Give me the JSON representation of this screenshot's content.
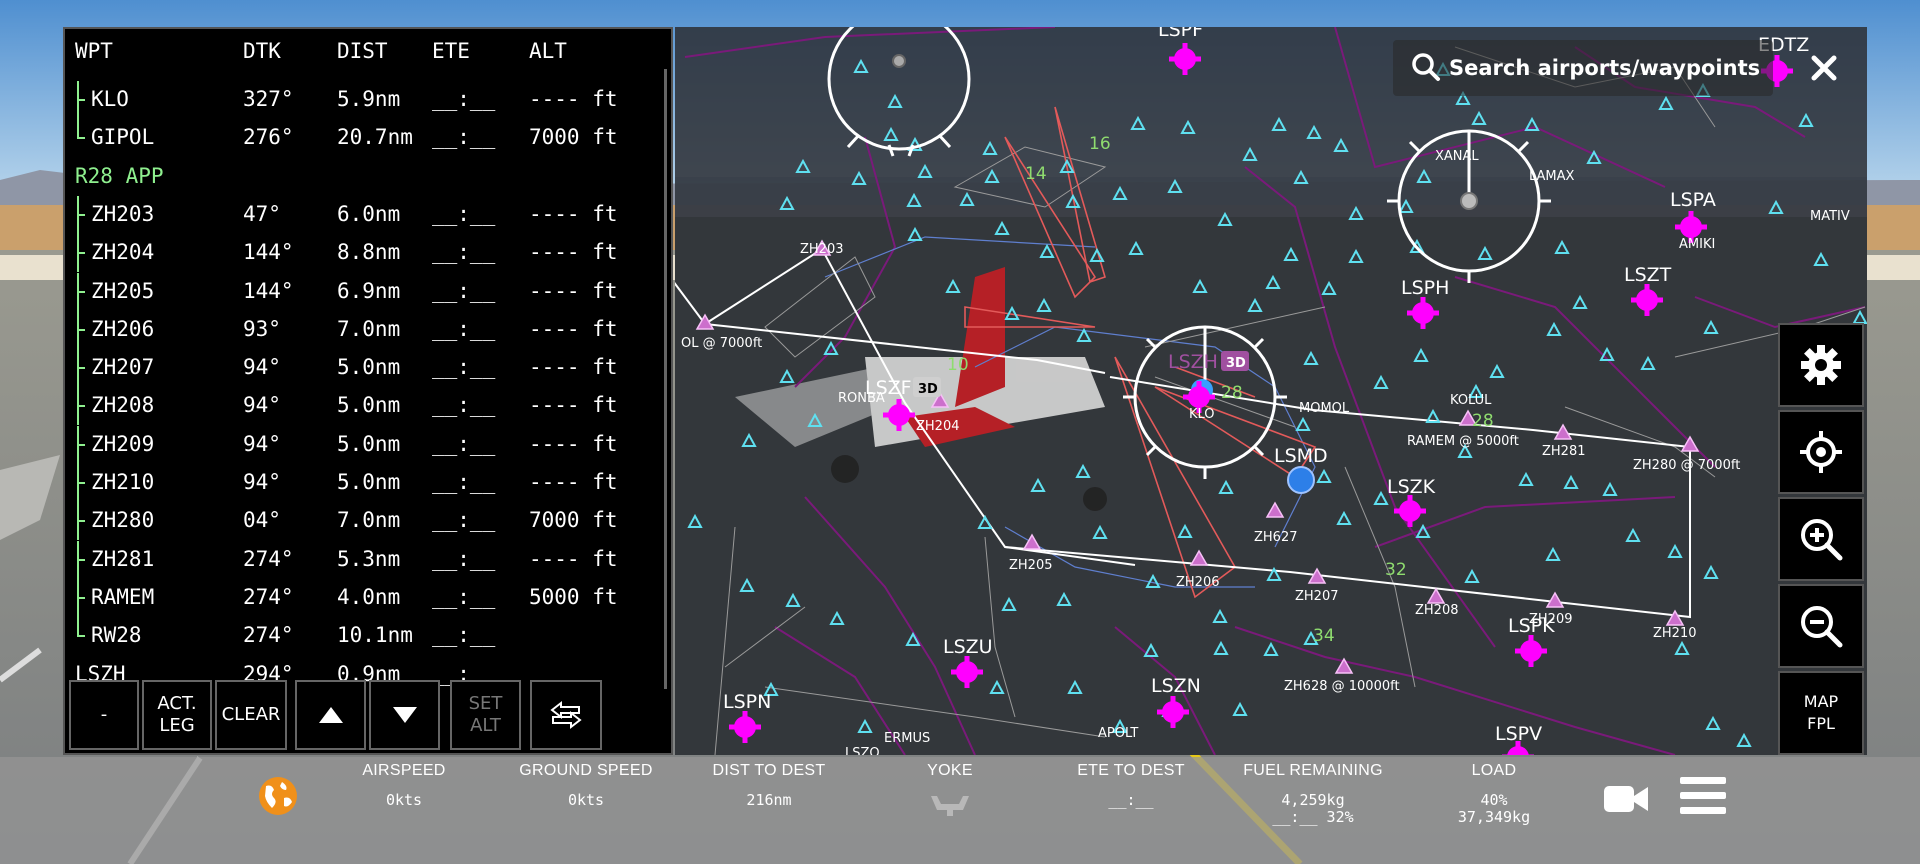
{
  "flight_plan": {
    "headers": {
      "wpt": "WPT",
      "dtk": "DTK",
      "dist": "DIST",
      "ete": "ETE",
      "alt": "ALT"
    },
    "rows": [
      {
        "wpt": "KLO",
        "dtk": "327°",
        "dist": "5.9nm",
        "ete": "__:__",
        "alt": "---- ft",
        "kind": "leg"
      },
      {
        "wpt": "GIPOL",
        "dtk": "276°",
        "dist": "20.7nm",
        "ete": "__:__",
        "alt": "7000 ft",
        "kind": "leg-end"
      },
      {
        "wpt": "R28 APP",
        "dtk": "",
        "dist": "",
        "ete": "",
        "alt": "",
        "kind": "section"
      },
      {
        "wpt": "ZH203",
        "dtk": "47°",
        "dist": "6.0nm",
        "ete": "__:__",
        "alt": "---- ft",
        "kind": "leg"
      },
      {
        "wpt": "ZH204",
        "dtk": "144°",
        "dist": "8.8nm",
        "ete": "__:__",
        "alt": "---- ft",
        "kind": "leg"
      },
      {
        "wpt": "ZH205",
        "dtk": "144°",
        "dist": "6.9nm",
        "ete": "__:__",
        "alt": "---- ft",
        "kind": "leg"
      },
      {
        "wpt": "ZH206",
        "dtk": "93°",
        "dist": "7.0nm",
        "ete": "__:__",
        "alt": "---- ft",
        "kind": "leg"
      },
      {
        "wpt": "ZH207",
        "dtk": "94°",
        "dist": "5.0nm",
        "ete": "__:__",
        "alt": "---- ft",
        "kind": "leg"
      },
      {
        "wpt": "ZH208",
        "dtk": "94°",
        "dist": "5.0nm",
        "ete": "__:__",
        "alt": "---- ft",
        "kind": "leg"
      },
      {
        "wpt": "ZH209",
        "dtk": "94°",
        "dist": "5.0nm",
        "ete": "__:__",
        "alt": "---- ft",
        "kind": "leg"
      },
      {
        "wpt": "ZH210",
        "dtk": "94°",
        "dist": "5.0nm",
        "ete": "__:__",
        "alt": "---- ft",
        "kind": "leg"
      },
      {
        "wpt": "ZH280",
        "dtk": "04°",
        "dist": "7.0nm",
        "ete": "__:__",
        "alt": "7000 ft",
        "kind": "leg"
      },
      {
        "wpt": "ZH281",
        "dtk": "274°",
        "dist": "5.3nm",
        "ete": "__:__",
        "alt": "---- ft",
        "kind": "leg"
      },
      {
        "wpt": "RAMEM",
        "dtk": "274°",
        "dist": "4.0nm",
        "ete": "__:__",
        "alt": "5000 ft",
        "kind": "leg"
      },
      {
        "wpt": "RW28",
        "dtk": "274°",
        "dist": "10.1nm",
        "ete": "__:__",
        "alt": "",
        "kind": "leg-end"
      },
      {
        "wpt": "LSZH",
        "dtk": "294°",
        "dist": "0.9nm",
        "ete": "__:__",
        "alt": "",
        "kind": "top"
      }
    ],
    "buttons": {
      "minus": "-",
      "act_leg": "ACT.\nLEG",
      "clear": "CLEAR",
      "set_alt": "SET\nALT"
    }
  },
  "map": {
    "search_placeholder": "Search airports/waypoints",
    "map_fpl_label": "MAP\nFPL",
    "airports": [
      "LSPF",
      "EDTZ",
      "LSPA",
      "LSZT",
      "LSPH",
      "LSZH",
      "LSZF",
      "LSMD",
      "LSZK",
      "LSZU",
      "LSZN",
      "LSPN",
      "LSPK",
      "LSPV"
    ],
    "labels": {
      "lspf": "LSPF",
      "edtz": "EDTZ",
      "lspa": "LSPA",
      "lszt": "LSZT",
      "lsph": "LSPH",
      "lszh": "LSZH",
      "lszf": "LSZF",
      "lsmd": "LSMD",
      "lszk": "LSZK",
      "lszu": "LSZU",
      "lszn": "LSZN",
      "lspn": "LSPN",
      "lspk": "LSPK",
      "lspv": "LSPV",
      "lszo": "LSZO",
      "xanal": "XANAL",
      "lamax": "LAMAX",
      "amiki": "AMIKI",
      "mativ": "MATIV",
      "zh203": "ZH203",
      "ronba": "RONBA",
      "zh204": "ZH204",
      "zh205": "ZH205",
      "zh206": "ZH206",
      "zh207": "ZH207",
      "zh208": "ZH208",
      "zh209": "ZH209",
      "zh210": "ZH210",
      "zh280": "ZH280 @ 7000ft",
      "zh281": "ZH281",
      "ramem": "RAMEM @ 5000ft",
      "kolul": "KOLUL",
      "gipol": "OL @ 7000ft",
      "zh627": "ZH627",
      "zh628": "ZH628 @ 10000ft",
      "ermus": "ERMUS",
      "apolt": "APOLT",
      "klo": "KLO",
      "momol": "MOMOL",
      "badge3d": "3D",
      "rw14": "14",
      "rw16": "16",
      "rw10": "10",
      "rw28": "28",
      "rw32": "32",
      "rw34": "34",
      "rw28b": "28"
    }
  },
  "status_bar": {
    "airspeed": {
      "label": "AIRSPEED",
      "value": "0kts"
    },
    "ground_speed": {
      "label": "GROUND SPEED",
      "value": "0kts"
    },
    "dist_to_dest": {
      "label": "DIST TO DEST",
      "value": "216nm"
    },
    "yoke": {
      "label": "YOKE"
    },
    "ete_to_dest": {
      "label": "ETE TO DEST",
      "value": "__:__"
    },
    "fuel_remaining": {
      "label": "FUEL REMAINING",
      "value1": "4,259kg",
      "value2": "__:__ 32%"
    },
    "load": {
      "label": "LOAD",
      "value1": "40%",
      "value2": "37,349kg"
    }
  },
  "colors": {
    "airport": "#ff00ff",
    "waypoint": "#5fe0f0",
    "route": "#ffffff",
    "runway": "#7fdc7f",
    "airspace": "#7a1a7a",
    "globe": "#f0901a"
  }
}
